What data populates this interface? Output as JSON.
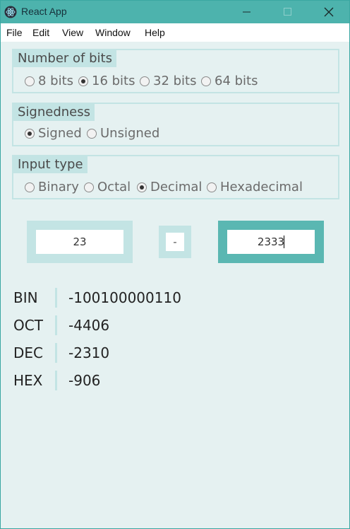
{
  "window": {
    "title": "React App",
    "accent_color": "#4db3ad",
    "icons": {
      "app": "electron-icon",
      "minimize": "minimize-icon",
      "maximize": "maximize-icon",
      "close": "close-icon"
    }
  },
  "menu": {
    "items": [
      "File",
      "Edit",
      "View",
      "Window",
      "Help"
    ]
  },
  "bits": {
    "legend": "Number of bits",
    "options": [
      "8 bits",
      "16 bits",
      "32 bits",
      "64 bits"
    ],
    "selected": "16 bits"
  },
  "signedness": {
    "legend": "Signedness",
    "options": [
      "Signed",
      "Unsigned"
    ],
    "selected": "Signed"
  },
  "input_type": {
    "legend": "Input type",
    "options": [
      "Binary",
      "Octal",
      "Decimal",
      "Hexadecimal"
    ],
    "selected": "Decimal"
  },
  "calculator": {
    "operand1": "23",
    "operator": "-",
    "operand2": "2333"
  },
  "results": [
    {
      "label": "BIN",
      "value": "-100100000110"
    },
    {
      "label": "OCT",
      "value": "-4406"
    },
    {
      "label": "DEC",
      "value": "-2310"
    },
    {
      "label": "HEX",
      "value": "-906"
    }
  ]
}
